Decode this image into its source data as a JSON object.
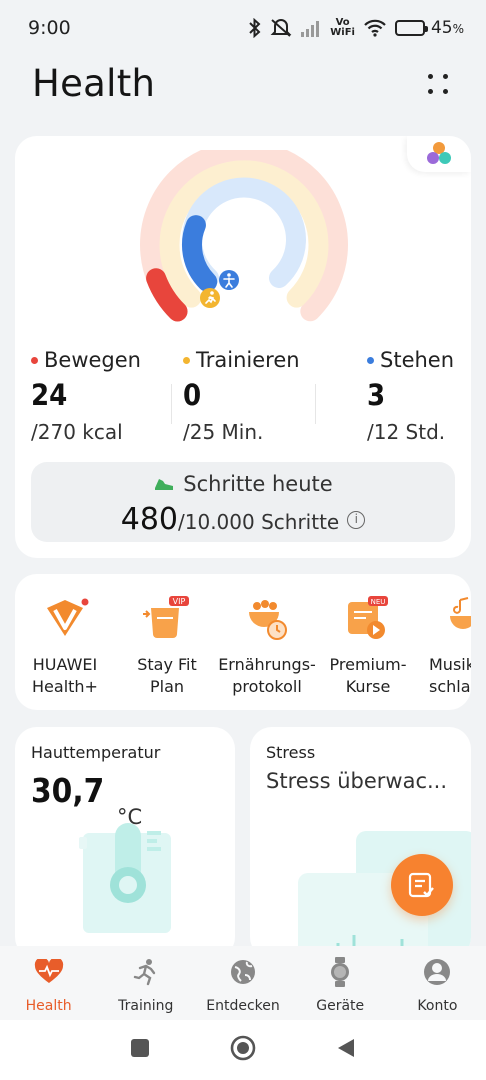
{
  "status_bar": {
    "time": "9:00",
    "battery_percent": 45,
    "battery_text": "45",
    "battery_symbol": "%",
    "volte_top": "Vo",
    "volte_bottom": "WiFi"
  },
  "header": {
    "title": "Health"
  },
  "activity": {
    "metrics": [
      {
        "label": "Bewegen",
        "value": "24",
        "goal": "/270 kcal",
        "color": "#e8453c"
      },
      {
        "label": "Trainieren",
        "value": "0",
        "goal": "/25 Min.",
        "color": "#f3b530"
      },
      {
        "label": "Stehen",
        "value": "3",
        "goal": "/12 Std.",
        "color": "#3b7ddd"
      }
    ],
    "rings": {
      "move_progress": 0.09,
      "exercise_progress": 0.0,
      "stand_progress": 0.25
    },
    "steps": {
      "title": "Schritte heute",
      "count": "480",
      "goal": "/10.000 Schritte",
      "info": "i"
    }
  },
  "services": [
    {
      "label": "HUAWEI\nHealth+",
      "icon": "huawei-health-plus-icon"
    },
    {
      "label": "Stay Fit\nPlan",
      "icon": "stay-fit-icon",
      "badge": "VIP"
    },
    {
      "label": "Ernährungs-\nprotokoll",
      "icon": "nutrition-icon"
    },
    {
      "label": "Premium-\nKurse",
      "icon": "premium-courses-icon",
      "badge": "NEU"
    },
    {
      "label": "Musik\nschla",
      "icon": "music-icon"
    }
  ],
  "tiles": {
    "skin": {
      "title": "Hauttemperatur",
      "value": "30,7",
      "unit": "°C"
    },
    "stress": {
      "title": "Stress",
      "subtitle": "Stress überwac..."
    }
  },
  "bottom_nav": [
    {
      "label": "Health",
      "icon": "heart-pulse-icon",
      "active": true
    },
    {
      "label": "Training",
      "icon": "runner-icon",
      "active": false
    },
    {
      "label": "Entdecken",
      "icon": "globe-icon",
      "active": false
    },
    {
      "label": "Geräte",
      "icon": "watch-icon",
      "active": false
    },
    {
      "label": "Konto",
      "icon": "person-icon",
      "active": false
    }
  ],
  "colors": {
    "accent": "#f7822f",
    "move": "#e8453c",
    "exercise": "#f3b530",
    "stand": "#3b7ddd"
  }
}
